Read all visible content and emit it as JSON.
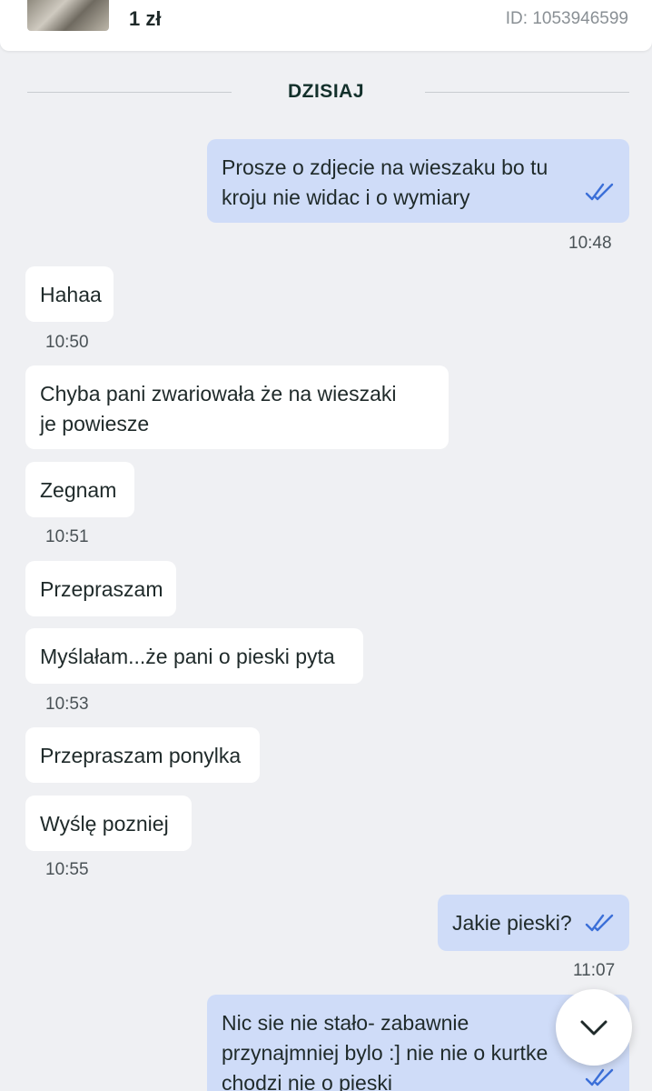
{
  "header": {
    "price": "1 zł",
    "listing_id": "ID: 1053946599"
  },
  "day_separator": "DZISIAJ",
  "messages": [
    {
      "direction": "outgoing",
      "lines": [
        "Prosze o zdjecie na wieszaku bo tu",
        "kroju nie widac i o wymiary"
      ],
      "time": "10:48",
      "read": true
    },
    {
      "direction": "incoming",
      "lines": [
        "Hahaa"
      ],
      "time": "10:50"
    },
    {
      "direction": "incoming",
      "lines": [
        "Chyba pani zwariowała że na wieszaki",
        "je powiesze"
      ]
    },
    {
      "direction": "incoming",
      "lines": [
        "Zegnam"
      ],
      "time": "10:51"
    },
    {
      "direction": "incoming",
      "lines": [
        "Przepraszam"
      ]
    },
    {
      "direction": "incoming",
      "lines": [
        "Myślałam...że pani o pieski pyta"
      ],
      "time": "10:53"
    },
    {
      "direction": "incoming",
      "lines": [
        "Przepraszam ponylka"
      ]
    },
    {
      "direction": "incoming",
      "lines": [
        "Wyślę pozniej"
      ],
      "time": "10:55"
    },
    {
      "direction": "outgoing",
      "lines": [
        "Jakie pieski?"
      ],
      "time": "11:07",
      "read": true
    },
    {
      "direction": "outgoing",
      "lines": [
        "Nic sie nie stało- zabawnie",
        "przynajmniej bylo :] nie nie o kurtke",
        "chodzi nie o pieski"
      ],
      "read": true
    }
  ],
  "colors": {
    "background": "#eff0f3",
    "incoming_bubble": "#ffffff",
    "outgoing_bubble": "#cfdcf8",
    "read_tick": "#3b6fd8"
  },
  "icons": {
    "read_receipt": "double-check-icon",
    "scroll_down": "chevron-down-icon"
  }
}
